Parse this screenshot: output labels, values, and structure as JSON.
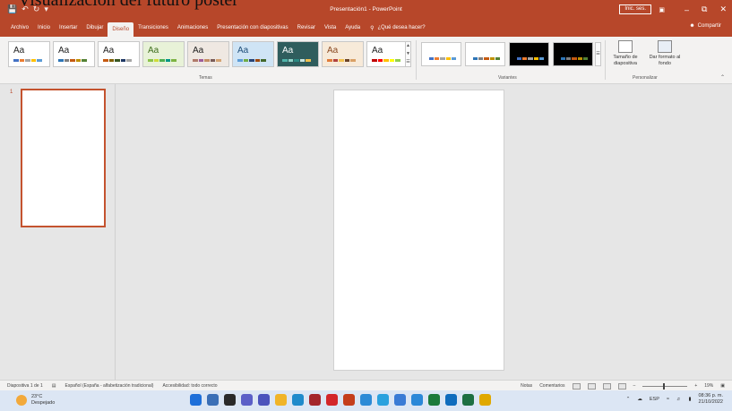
{
  "overlay_caption": "Visualización del futuro poster",
  "titlebar": {
    "title": "Presentación1 - PowerPoint",
    "signin": "Inic. ses.",
    "quick_access": [
      "save-icon",
      "undo-icon",
      "redo-icon",
      "customize-icon"
    ]
  },
  "tabs": [
    {
      "label": "Archivo"
    },
    {
      "label": "Inicio"
    },
    {
      "label": "Insertar"
    },
    {
      "label": "Dibujar"
    },
    {
      "label": "Diseño"
    },
    {
      "label": "Transiciones"
    },
    {
      "label": "Animaciones"
    },
    {
      "label": "Presentación con diapositivas"
    },
    {
      "label": "Revisar"
    },
    {
      "label": "Vista"
    },
    {
      "label": "Ayuda"
    }
  ],
  "active_tab": "Diseño",
  "tellme": "¿Qué desea hacer?",
  "share": "Compartir",
  "ribbon": {
    "themes_label": "Temas",
    "variants_label": "Variantes",
    "customize_label": "Personalizar",
    "slide_size": "Tamaño de diapositiva",
    "format_bg": "Dar formato al fondo",
    "themes": [
      {
        "text": "Aa",
        "bg": "#ffffff",
        "fg": "#222222",
        "colors": [
          "#4472c4",
          "#ed7d31",
          "#a5a5a5",
          "#ffc000",
          "#5b9bd5"
        ]
      },
      {
        "text": "Aa",
        "bg": "#ffffff",
        "fg": "#222222",
        "colors": [
          "#2e75b6",
          "#7f7f7f",
          "#c55a11",
          "#bf9000",
          "#548235"
        ]
      },
      {
        "text": "Aa",
        "bg": "#ffffff",
        "fg": "#222222",
        "colors": [
          "#c55a11",
          "#7f6000",
          "#375623",
          "#1f3864",
          "#a5a5a5"
        ]
      },
      {
        "text": "Aa",
        "bg": "#e8f2d8",
        "fg": "#3f6e1d",
        "colors": [
          "#8bc34a",
          "#cddc39",
          "#4caf50",
          "#009688",
          "#7cb342"
        ]
      },
      {
        "text": "Aa",
        "bg": "#efe8e2",
        "fg": "#222222",
        "colors": [
          "#b07a6a",
          "#9e5c9a",
          "#c38d63",
          "#7a5c58",
          "#d4a373"
        ]
      },
      {
        "text": "Aa",
        "bg": "#cfe4f5",
        "fg": "#1f4e79",
        "colors": [
          "#5b9bd5",
          "#70ad47",
          "#264478",
          "#9e480e",
          "#43682b"
        ]
      },
      {
        "text": "Aa",
        "bg": "#2f5d5d",
        "fg": "#ffffff",
        "colors": [
          "#4fb3a9",
          "#8fd3c7",
          "#2b8a83",
          "#c9e5e0",
          "#f2c14e"
        ]
      },
      {
        "text": "Aa",
        "bg": "#f7ead9",
        "fg": "#8a4a22",
        "colors": [
          "#e07b39",
          "#b0413e",
          "#f2c14e",
          "#6b4226",
          "#d9a066"
        ]
      },
      {
        "text": "Aa",
        "bg": "#ffffff",
        "fg": "#222222",
        "colors": [
          "#c00000",
          "#ff0000",
          "#ffc000",
          "#ffff00",
          "#92d050"
        ]
      }
    ],
    "variants": [
      {
        "bg": "#ffffff",
        "colors": [
          "#4472c4",
          "#ed7d31",
          "#a5a5a5",
          "#ffc000",
          "#5b9bd5"
        ]
      },
      {
        "bg": "#ffffff",
        "colors": [
          "#2e75b6",
          "#7f7f7f",
          "#c55a11",
          "#bf9000",
          "#548235"
        ]
      },
      {
        "bg": "#000000",
        "colors": [
          "#4472c4",
          "#ed7d31",
          "#a5a5a5",
          "#ffc000",
          "#5b9bd5"
        ]
      },
      {
        "bg": "#000000",
        "colors": [
          "#2e75b6",
          "#7f7f7f",
          "#c55a11",
          "#bf9000",
          "#548235"
        ]
      }
    ]
  },
  "slides": {
    "current_number": "1"
  },
  "statusbar": {
    "slide_info": "Diapositiva 1 de 1",
    "language": "Español (España - alfabetización tradicional)",
    "accessibility": "Accesibilidad: todo correcto",
    "notes": "Notas",
    "comments": "Comentarios",
    "zoom": "19%",
    "zoom_fraction": 0.45
  },
  "taskbar": {
    "temp": "23°C",
    "weather": "Despejado",
    "lang": "ESP",
    "time": "08:36 p. m.",
    "date": "21/10/2022",
    "apps": [
      {
        "name": "windows-start-icon",
        "color": "#1e6fd9"
      },
      {
        "name": "search-icon",
        "color": "#3b6fb6"
      },
      {
        "name": "task-view-icon",
        "color": "#2a2a2a"
      },
      {
        "name": "chat-icon",
        "color": "#5b5fc7"
      },
      {
        "name": "teams-icon",
        "color": "#4b53bc"
      },
      {
        "name": "file-explorer-icon",
        "color": "#f0b429"
      },
      {
        "name": "edge-icon",
        "color": "#1f8acb"
      },
      {
        "name": "access-icon",
        "color": "#a4262c"
      },
      {
        "name": "acrobat-icon",
        "color": "#d3262a"
      },
      {
        "name": "powerpoint-icon",
        "color": "#c43e1c"
      },
      {
        "name": "photos-icon",
        "color": "#2c8ad6"
      },
      {
        "name": "store-icon",
        "color": "#2aa1de"
      },
      {
        "name": "app-icon-1",
        "color": "#3a7bd5"
      },
      {
        "name": "app-icon-2",
        "color": "#2b88d8"
      },
      {
        "name": "app-icon-3",
        "color": "#1b7a3b"
      },
      {
        "name": "outlook-icon",
        "color": "#0f6cbd"
      },
      {
        "name": "excel-icon",
        "color": "#1d6f42"
      },
      {
        "name": "chrome-icon",
        "color": "#e0a800"
      }
    ]
  }
}
